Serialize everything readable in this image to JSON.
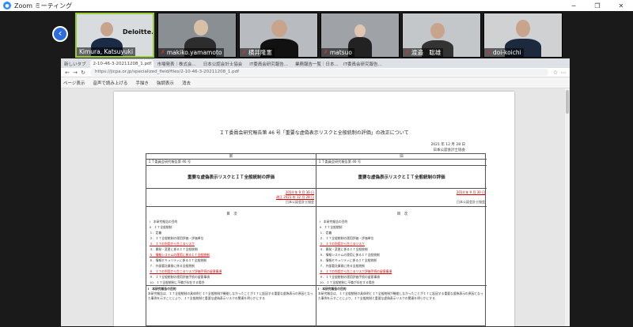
{
  "window": {
    "title": "Zoom ミーティング"
  },
  "participants": [
    {
      "name": "Kimura, Katsuyuki",
      "muted": false,
      "bg": "#d9dcdf",
      "logo": "Deloitte."
    },
    {
      "name": "makiko.yamamoto",
      "muted": true,
      "bg": "#8a8f94"
    },
    {
      "name": "横井隆憲",
      "muted": true,
      "bg": "#b8bcc0"
    },
    {
      "name": "matsuo",
      "muted": true,
      "bg": "#9fa3a7"
    },
    {
      "name": "渡邉　聡雄",
      "muted": true,
      "bg": "#c4c7ca"
    },
    {
      "name": "doi-koichi",
      "muted": true,
      "bg": "#cfd1d3"
    }
  ],
  "browser": {
    "tabs": [
      "新しいタブ",
      "2-10-46-3-20211208_1.pdf",
      "市場発表｜株式会...",
      "日本公認会計士協会",
      "IT委員会研究報告...",
      "業務報告一覧｜日本...",
      "IT委員会研究報告..."
    ],
    "url": "https://jicpa.or.jp/specialized_field/files/2-10-46-3-20211208_1.pdf",
    "toolbar": [
      "ページ表示",
      "音声で読み上げる",
      "手描き",
      "強調表示",
      "消去"
    ]
  },
  "pdf": {
    "title": "ＩＴ委員会研究報告第 46 号「重要な虚偽表示リスクと全般統制の評価」の改正について",
    "date": "2021 年 12 月 28 日",
    "org": "日本公認会計士協会",
    "col_new": "新",
    "col_old": "旧",
    "report_no": "ＩＴ委員会研究報告第 46 号",
    "report_title": "重要な虚偽表示リスクとＩＴ全般統制の評価",
    "new_date1": "2014 年 9 月 30 日",
    "new_date2": "改正 2021 年 12 月 28 日",
    "old_date1": "2014 年 9 月 30 日",
    "toc": "目　次",
    "toc_items": [
      "Ⅰ　本研究報告の目的",
      "Ⅱ　ＩＴ全般統制",
      "１．定義",
      "２．ＩＴ全般統制の運用評価・評価単位",
      "３．ＩＴの利用から生じるリスク",
      "４．開発・変更に係るＩＴ全般統制",
      "５．情報システムの運用に係るＩＴ全般統制",
      "６．情報セキュリティに係るＩＴ全般統制",
      "７．外部委託業務に係る全般統制",
      "８．ＩＴの利用から生じるリスク評価手続の留意事項",
      "９．ＩＴ全般統制の運用評価手続の留意事項",
      "10．ＩＴ全般統制に不備が存在する場合"
    ],
    "sec1": "Ⅰ　本研究報告の目的",
    "sec1_body": "本研究報告は、ＩＴ全般統制の具体例とＩＴ全般統制が機能しなかったことがＩＴに起因する重要な虚偽表示の原因となった事例を示すことにより、ＩＴ全般統制と重要な虚偽表示リスクの関連を明らかにする"
  }
}
